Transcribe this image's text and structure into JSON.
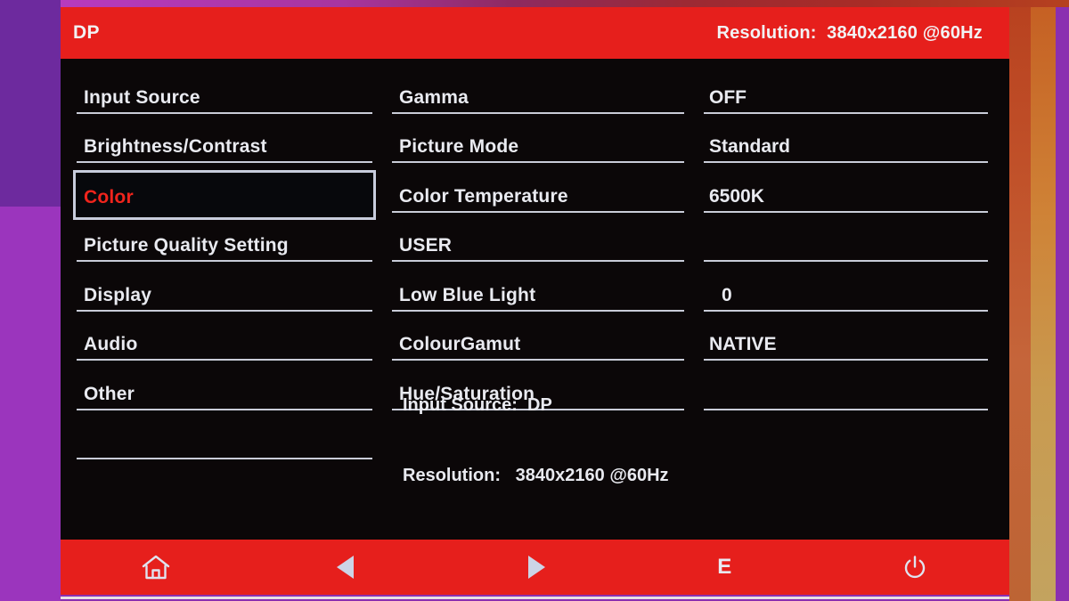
{
  "header": {
    "input_source": "DP",
    "resolution_label": "Resolution:",
    "resolution_value": "3840x2160 @60Hz",
    "resolution_full": "Resolution:  3840x2160 @60Hz",
    "bar_color": "#e61f1c"
  },
  "menu": {
    "selected_index": 2,
    "highlight_text_color": "#f0241c",
    "highlight_border_color": "#c8cddd",
    "categories": [
      {
        "label": "Input Source"
      },
      {
        "label": "Brightness/Contrast"
      },
      {
        "label": "Color"
      },
      {
        "label": "Picture Quality Setting"
      },
      {
        "label": "Display"
      },
      {
        "label": "Audio"
      },
      {
        "label": "Other"
      },
      {
        "label": ""
      }
    ],
    "settings": [
      {
        "label": "Gamma",
        "value": "OFF"
      },
      {
        "label": "Picture Mode",
        "value": "Standard"
      },
      {
        "label": "Color Temperature",
        "value": "6500K"
      },
      {
        "label": "USER",
        "value": ""
      },
      {
        "label": "Low Blue Light",
        "value": "0"
      },
      {
        "label": "ColourGamut",
        "value": "NATIVE"
      },
      {
        "label": "Hue/Saturation",
        "value": ""
      },
      {
        "label": "",
        "value": ""
      }
    ]
  },
  "info": {
    "line1": "Input Source:  DP",
    "line2": "Resolution:   3840x2160 @60Hz"
  },
  "footer": {
    "buttons": [
      {
        "name": "home-icon",
        "label": ""
      },
      {
        "name": "left-arrow-icon",
        "label": ""
      },
      {
        "name": "right-arrow-icon",
        "label": ""
      },
      {
        "name": "exit-key",
        "label": "E"
      },
      {
        "name": "power-icon",
        "label": ""
      }
    ],
    "bar_color": "#e61f1c"
  },
  "palette": {
    "osd_background": "#0b0708",
    "text": "#e9eaf0",
    "rule": "#c9ccd8",
    "accent_red": "#e61f1c"
  }
}
